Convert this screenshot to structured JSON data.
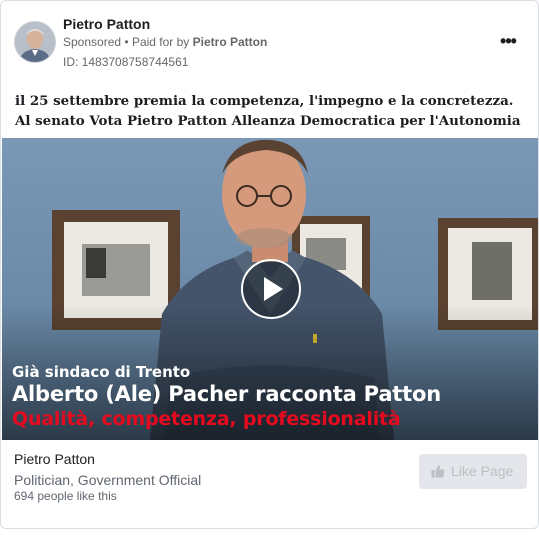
{
  "header": {
    "page_name": "Pietro Patton",
    "sponsored": "Sponsored",
    "separator": "•",
    "paid_for_prefix": "Paid for by",
    "paid_for_name": "Pietro Patton",
    "ad_id": "ID: 1483708758744561",
    "more_label": "•••"
  },
  "post": {
    "line1": "il 25 settembre premia la competenza, l'impegno e la concretezza.",
    "line2": "Al senato Vota Pietro Patton Alleanza Democratica per l'Autonomia"
  },
  "video": {
    "caption_top": "Già sindaco di Trento",
    "caption_main": "Alberto (Ale) Pacher racconta Patton",
    "caption_sub": "Qualità, competenza, professionalità"
  },
  "footer": {
    "name": "Pietro Patton",
    "category": "Politician, Government Official",
    "likes": "694 people like this",
    "like_button": "Like Page"
  },
  "colors": {
    "caption_red": "#e60a1e",
    "wall_blue": "#6f8fae",
    "button_bg": "#e4e6eb"
  }
}
